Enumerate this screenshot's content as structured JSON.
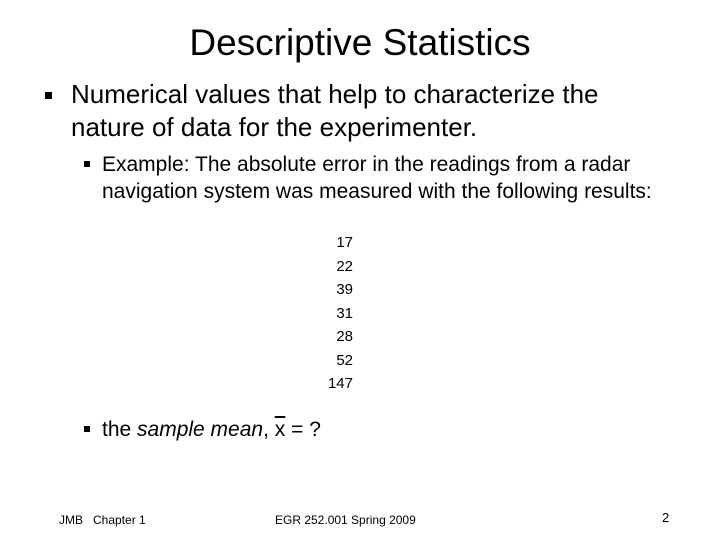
{
  "slide": {
    "title": "Descriptive Statistics",
    "bullets": [
      {
        "level": 1,
        "text": "Numerical values that help to characterize the nature of data for the experimenter."
      },
      {
        "level": 2,
        "text": "Example: The absolute error in the readings from a radar navigation system was measured with the following results:"
      }
    ],
    "readings": [
      "17",
      "22",
      "39",
      "31",
      "28",
      "52",
      "147"
    ],
    "mean_question": {
      "prefix": "the ",
      "italic": "sample mean",
      "comma": ", ",
      "symbol": "x",
      "suffix": " = ?"
    },
    "footer": {
      "left": "JMB   Chapter 1",
      "center": "EGR 252.001 Spring 2009",
      "page_number": "2"
    }
  }
}
